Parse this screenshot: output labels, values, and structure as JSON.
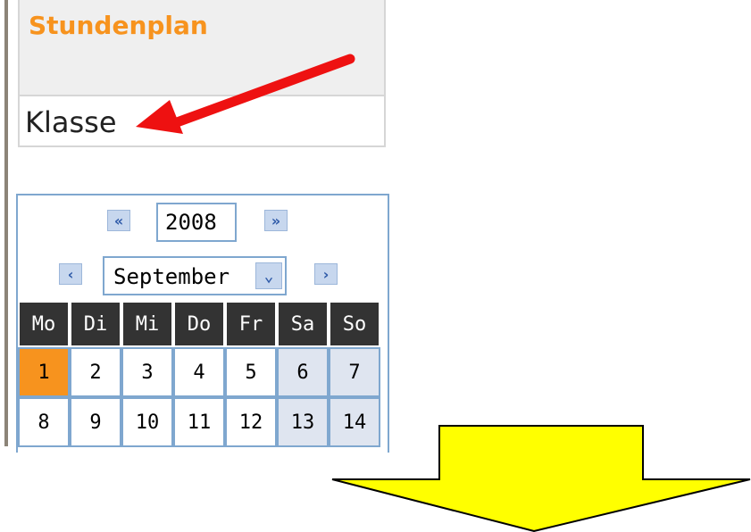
{
  "sidebar": {
    "title": "Stundenplan",
    "item": "Klasse"
  },
  "calendar": {
    "prev_year_icon": "double-chevron-left-icon",
    "next_year_icon": "double-chevron-right-icon",
    "prev_month_icon": "chevron-left-icon",
    "next_month_icon": "chevron-right-icon",
    "year": "2008",
    "month": "September",
    "weekdays": [
      "Mo",
      "Di",
      "Mi",
      "Do",
      "Fr",
      "Sa",
      "So"
    ],
    "weeks": [
      [
        "1",
        "2",
        "3",
        "4",
        "5",
        "6",
        "7"
      ],
      [
        "8",
        "9",
        "10",
        "11",
        "12",
        "13",
        "14"
      ]
    ],
    "today": "1"
  },
  "colors": {
    "accent_orange": "#f7931e",
    "header_dark": "#333333",
    "border_blue": "#7fa7cf",
    "weekend_bg": "#dfe5f0",
    "arrow_red": "#ee1111",
    "arrow_yellow": "#ffff00"
  }
}
